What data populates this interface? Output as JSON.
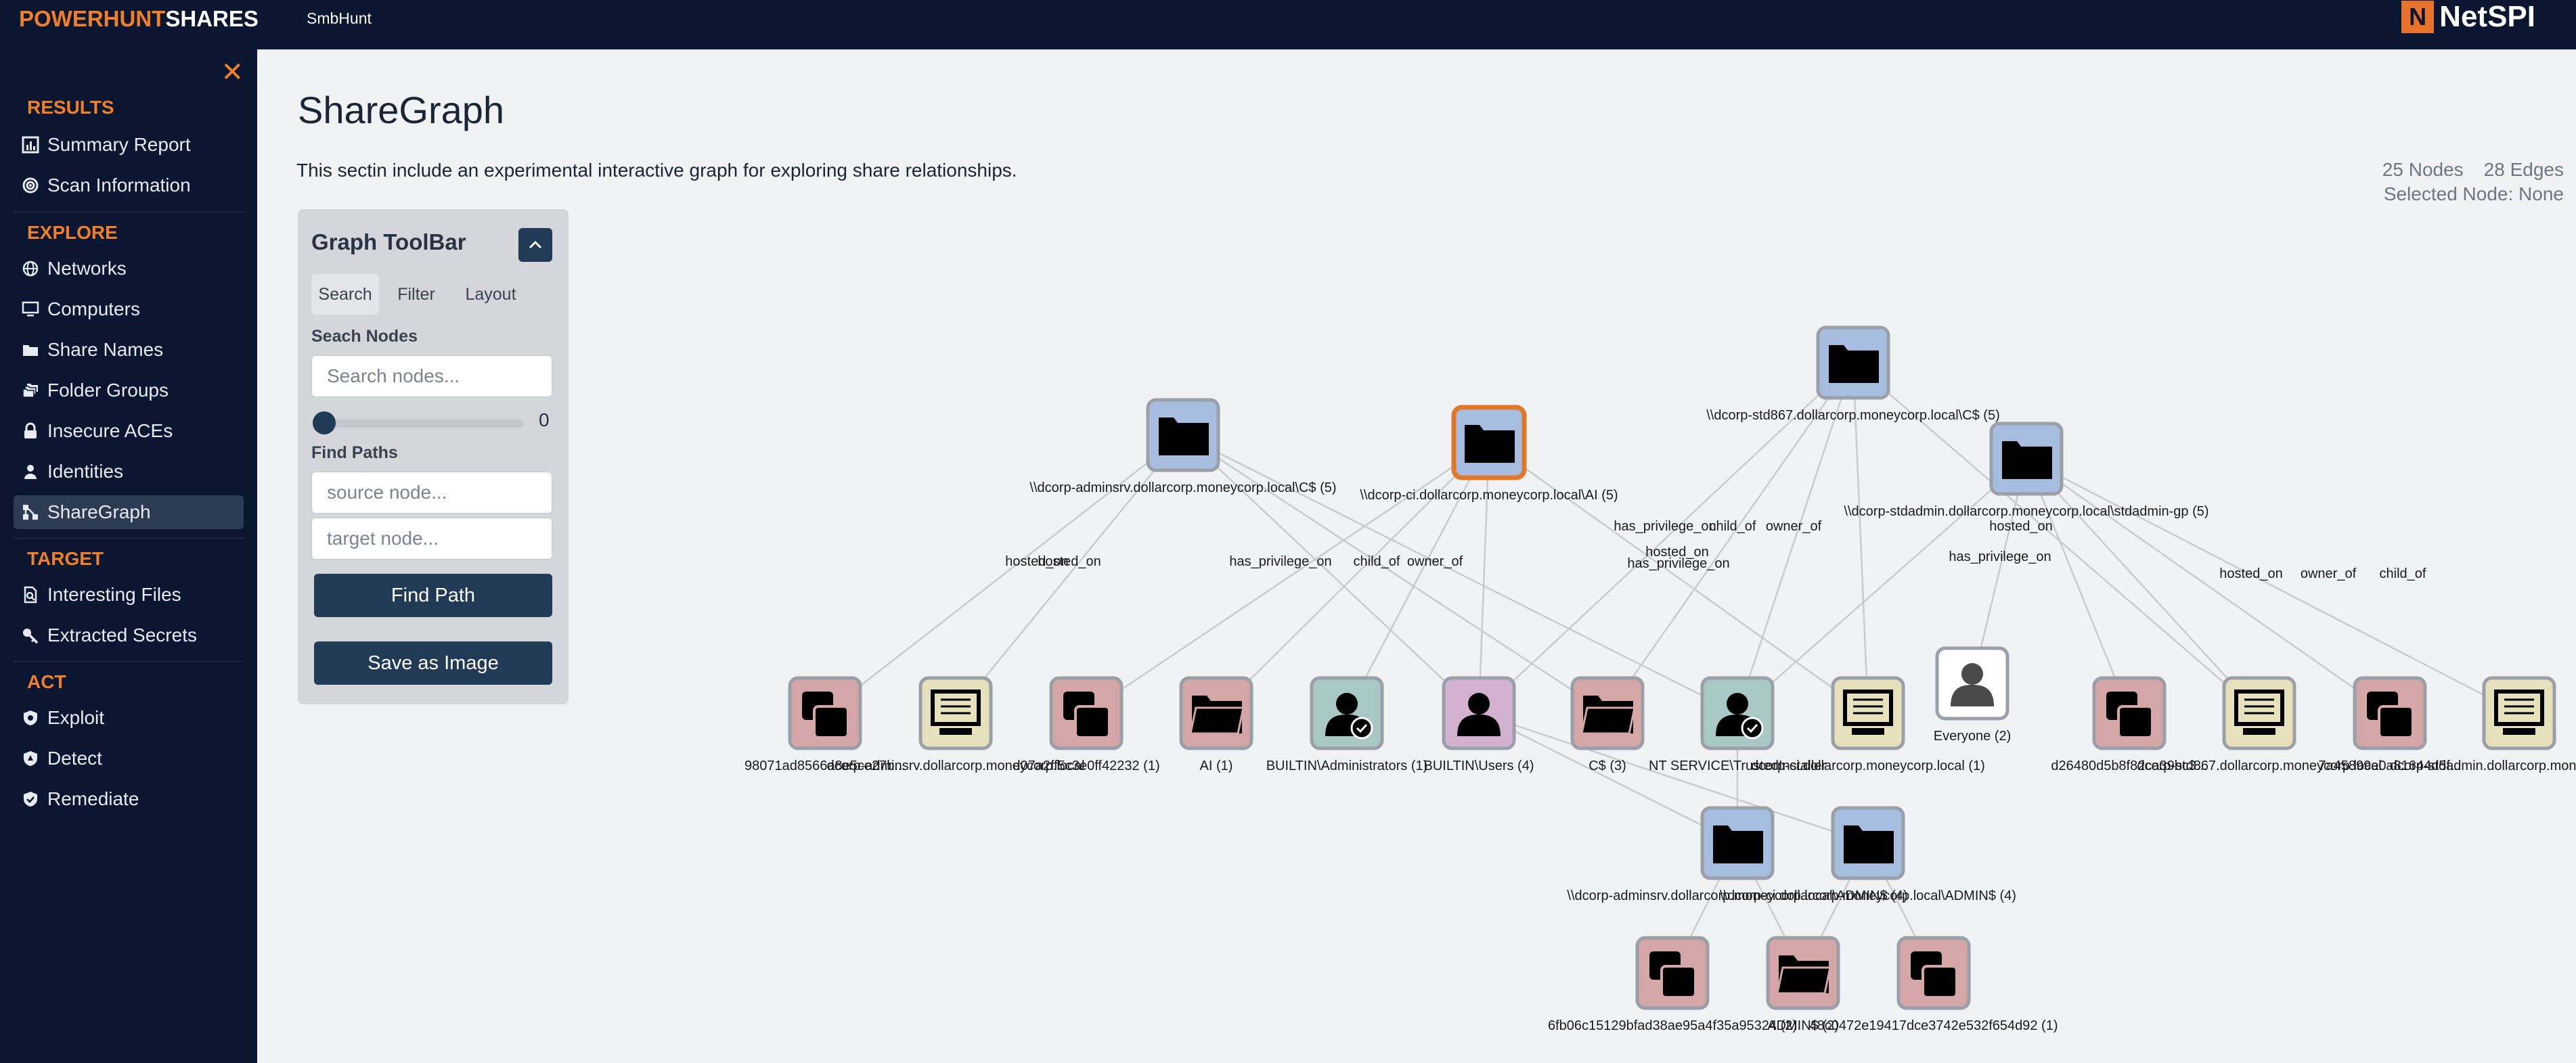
{
  "topbar": {
    "brand_part1": "POWERHUNT",
    "brand_part2": "SHARES",
    "nav_item": "SmbHunt",
    "logo_text": "NetSPI"
  },
  "sidebar": {
    "sections": [
      {
        "title": "RESULTS",
        "items": [
          {
            "label": "Summary Report",
            "icon": "bar-chart-icon"
          },
          {
            "label": "Scan Information",
            "icon": "radar-icon"
          }
        ]
      },
      {
        "title": "EXPLORE",
        "items": [
          {
            "label": "Networks",
            "icon": "globe-icon"
          },
          {
            "label": "Computers",
            "icon": "monitor-icon"
          },
          {
            "label": "Share Names",
            "icon": "folder-icon"
          },
          {
            "label": "Folder Groups",
            "icon": "folders-icon"
          },
          {
            "label": "Insecure ACEs",
            "icon": "lock-icon"
          },
          {
            "label": "Identities",
            "icon": "person-icon"
          },
          {
            "label": "ShareGraph",
            "icon": "graph-icon"
          }
        ]
      },
      {
        "title": "TARGET",
        "items": [
          {
            "label": "Interesting Files",
            "icon": "file-search-icon"
          },
          {
            "label": "Extracted Secrets",
            "icon": "key-icon"
          }
        ]
      },
      {
        "title": "ACT",
        "items": [
          {
            "label": "Exploit",
            "icon": "shield-bug-icon"
          },
          {
            "label": "Detect",
            "icon": "shield-alert-icon"
          },
          {
            "label": "Remediate",
            "icon": "shield-check-icon"
          }
        ]
      }
    ],
    "active_item": "ShareGraph",
    "accent_color": "#f07f2a"
  },
  "main": {
    "title": "ShareGraph",
    "description": "This sectin include an experimental interactive graph for exploring share relationships.",
    "stats": {
      "nodes": "25 Nodes",
      "edges": "28 Edges",
      "selected": "Selected Node: None"
    }
  },
  "toolbar": {
    "title": "Graph ToolBar",
    "tabs": [
      "Search",
      "Filter",
      "Layout"
    ],
    "search_label": "Seach Nodes",
    "search_placeholder": "Search nodes...",
    "slider_value": "0",
    "paths_label": "Find Paths",
    "source_placeholder": "source node...",
    "target_placeholder": "target node...",
    "find_path_label": "Find Path",
    "save_label": "Save as Image"
  },
  "graph": {
    "nodes": [
      {
        "id": "n1",
        "type": "share",
        "label": "\\\\dcorp-adminsrv.dollarcorp.moneycorp.local\\C$ (5)"
      },
      {
        "id": "n2",
        "type": "share",
        "label": "\\\\dcorp-ci.dollarcorp.moneycorp.local\\AI (5)",
        "highlight": true
      },
      {
        "id": "n3",
        "type": "share",
        "label": "\\\\dcorp-std867.dollarcorp.moneycorp.local\\C$ (5)"
      },
      {
        "id": "n4",
        "type": "share",
        "label": "\\\\dcorp-stdadmin.dollarcorp.moneycorp.local\\stdadmin-gp (5)"
      },
      {
        "id": "n5",
        "type": "group",
        "label": "98071ad8566a8e5ce27b..."
      },
      {
        "id": "n6",
        "type": "computer",
        "label": "dcorp-adminsrv.dollarcorp.moneycorp.local"
      },
      {
        "id": "n7",
        "type": "group",
        "label": "d07a2ff5c3e0ff42232 (1)"
      },
      {
        "id": "n8",
        "type": "folder",
        "label": "AI (1)"
      },
      {
        "id": "n9",
        "type": "admin",
        "label": "BUILTIN\\Administrators (1)"
      },
      {
        "id": "n10",
        "type": "user",
        "label": "BUILTIN\\Users (4)"
      },
      {
        "id": "n11",
        "type": "folder",
        "label": "C$ (3)"
      },
      {
        "id": "n12",
        "type": "admin",
        "label": "NT SERVICE\\TrustedInstaller"
      },
      {
        "id": "n13",
        "type": "computer",
        "label": "dcorp-ci.dollarcorp.moneycorp.local (1)"
      },
      {
        "id": "n14",
        "type": "everyone",
        "label": "Everyone (2)"
      },
      {
        "id": "n15",
        "type": "group",
        "label": "d26480d5b8f82ca39bc3..."
      },
      {
        "id": "n16",
        "type": "computer",
        "label": "dcorp-std867.dollarcorp.moneycorp.local"
      },
      {
        "id": "n17",
        "type": "group",
        "label": "7a45899e0a81644d5f..."
      },
      {
        "id": "n18",
        "type": "computer",
        "label": "dcorp-stdadmin.dollarcorp.moneycorp.local"
      },
      {
        "id": "n19",
        "type": "share",
        "label": "\\\\dcorp-adminsrv.dollarcorp.moneycorp.local\\ADMIN$ (4)"
      },
      {
        "id": "n20",
        "type": "share",
        "label": "\\\\dcorp-ci.dollarcorp.moneycorp.local\\ADMIN$ (4)"
      },
      {
        "id": "n21",
        "type": "group",
        "label": "6fb06c15129bfad38ae95a4f35a95324 (2)"
      },
      {
        "id": "n22",
        "type": "folder",
        "label": "ADMIN$ (2)"
      },
      {
        "id": "n23",
        "type": "group",
        "label": "48c0472e19417dce3742e532f654d92 (1)"
      }
    ],
    "edge_labels": [
      "hosted_on",
      "hosted_on",
      "has_privilege_on",
      "child_of",
      "owner_of",
      "has_privilege_on",
      "child_of",
      "owner_of",
      "hosted_on",
      "has_privilege_on",
      "has_privilege_on",
      "hosted_on",
      "hosted_on",
      "owner_of",
      "child_of"
    ]
  }
}
